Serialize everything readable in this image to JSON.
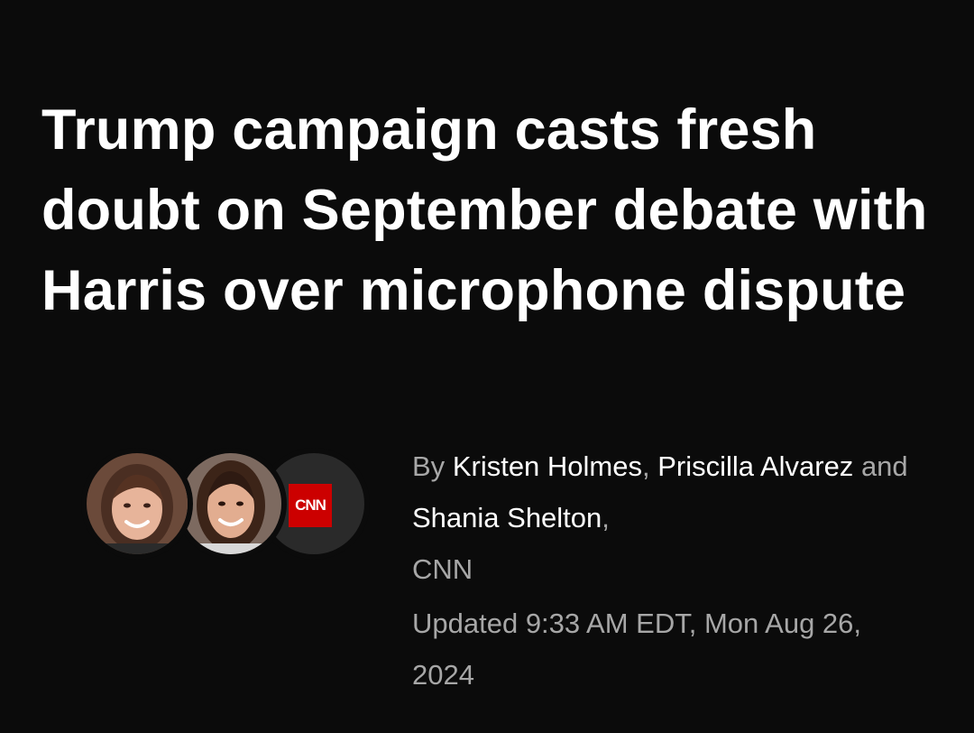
{
  "headline": "Trump campaign casts fresh doubt on September debate with Harris over microphone dispute",
  "byline": {
    "prefix": "By",
    "author1": "Kristen Holmes",
    "sep1": ",",
    "author2": "Priscilla Alvarez",
    "conj": "and",
    "author3": "Shania Shelton",
    "sep2": ",",
    "outlet": "CNN"
  },
  "avatars": {
    "logo_text": "CNN",
    "brand_color": "#cc0000"
  },
  "timestamp": "Updated 9:33 AM EDT, Mon Aug 26, 2024",
  "colors": {
    "background": "#0b0b0b",
    "text": "#ffffff",
    "muted": "#a7a7a7"
  }
}
